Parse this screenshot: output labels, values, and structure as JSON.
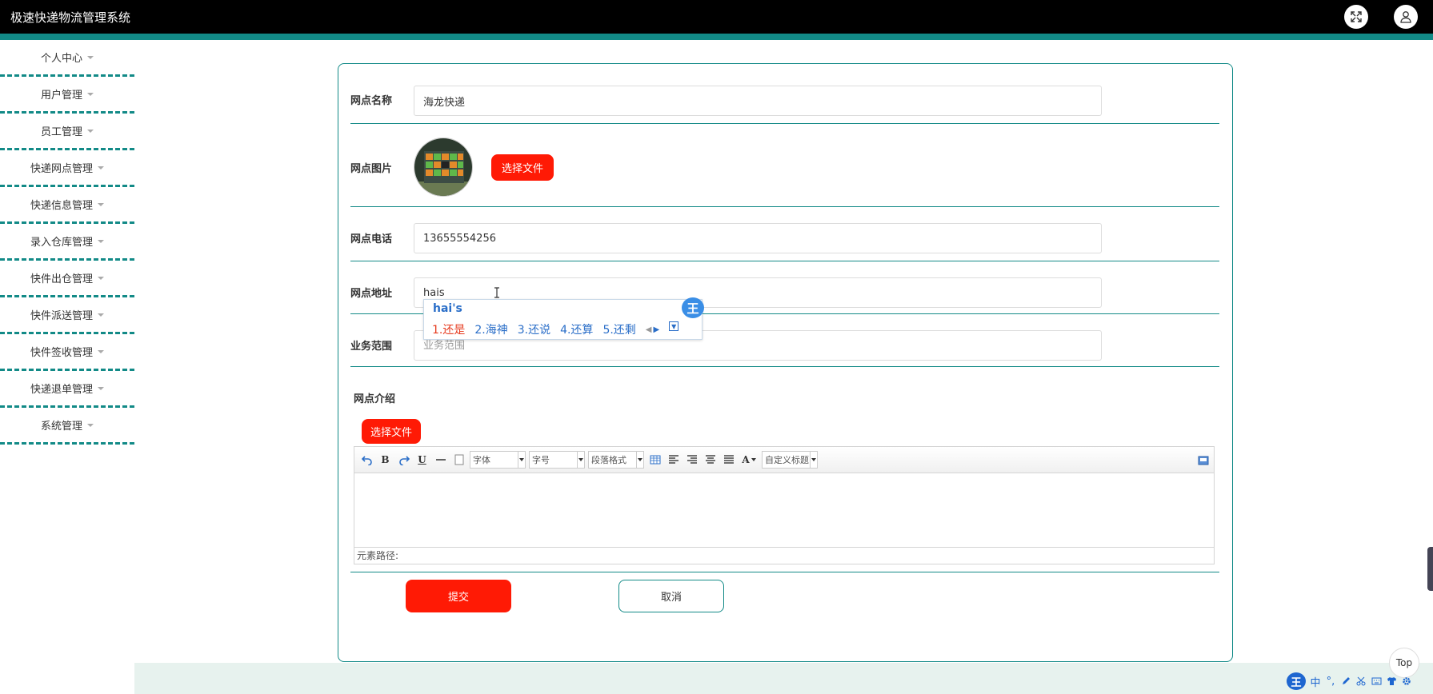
{
  "app": {
    "title": "极速快递物流管理系统"
  },
  "header": {
    "fullscreen_icon": "fullscreen-icon",
    "user_icon": "user-icon"
  },
  "sidebar": {
    "items": [
      {
        "label": "个人中心"
      },
      {
        "label": "用户管理"
      },
      {
        "label": "员工管理"
      },
      {
        "label": "快递网点管理"
      },
      {
        "label": "快递信息管理"
      },
      {
        "label": "录入仓库管理"
      },
      {
        "label": "快件出仓管理"
      },
      {
        "label": "快件派送管理"
      },
      {
        "label": "快件签收管理"
      },
      {
        "label": "快递退单管理"
      },
      {
        "label": "系统管理"
      }
    ]
  },
  "form": {
    "name_label": "网点名称",
    "name_value": "海龙快递",
    "image_label": "网点图片",
    "choose_file_label": "选择文件",
    "phone_label": "网点电话",
    "phone_value": "13655554256",
    "address_label": "网点地址",
    "address_value": "hais",
    "scope_label": "业务范围",
    "scope_placeholder": "业务范围",
    "intro_label": "网点介绍",
    "intro_choose_file_label": "选择文件",
    "submit_label": "提交",
    "cancel_label": "取消"
  },
  "editor": {
    "font_select": "字体",
    "size_select": "字号",
    "paragraph_select": "段落格式",
    "custom_title_select": "自定义标题",
    "bold": "B",
    "underline": "U",
    "font_color": "A",
    "element_path_label": "元素路径:"
  },
  "ime": {
    "composition": "hai's",
    "candidates": [
      "1.还是",
      "2.海神",
      "3.还说",
      "4.还算",
      "5.还剩"
    ],
    "badge": "王"
  },
  "top_button_label": "Top",
  "taskbar": {
    "badge": "王",
    "lang": "中",
    "punct": "°,"
  }
}
